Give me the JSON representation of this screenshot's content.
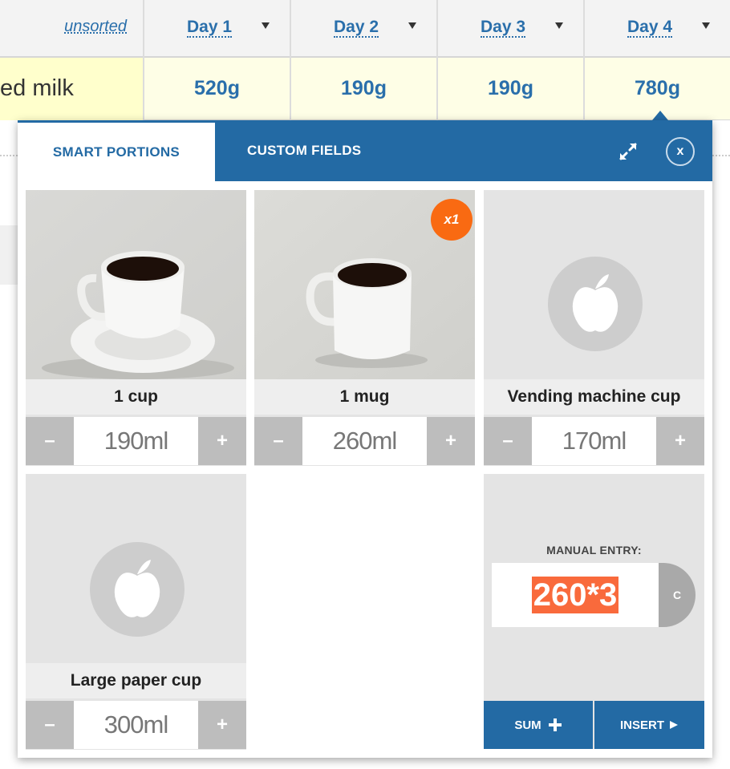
{
  "table": {
    "sort_label": "unsorted",
    "days": [
      {
        "label": "Day 1",
        "amount": "520g"
      },
      {
        "label": "Day 2",
        "amount": "190g"
      },
      {
        "label": "Day 3",
        "amount": "190g"
      },
      {
        "label": "Day 4",
        "amount": "780g"
      }
    ],
    "row_label": "ed milk"
  },
  "popup": {
    "tabs": {
      "smart": "SMART PORTIONS",
      "custom": "CUSTOM FIELDS"
    },
    "close_label": "x",
    "portions": [
      {
        "name": "1 cup",
        "value": "190ml",
        "minus": "–",
        "plus": "+",
        "image": "coffee-cup-saucer-photo"
      },
      {
        "name": "1 mug",
        "value": "260ml",
        "minus": "–",
        "plus": "+",
        "image": "coffee-mug-photo",
        "badge": "x1"
      },
      {
        "name": "Vending machine cup",
        "value": "170ml",
        "minus": "–",
        "plus": "+",
        "image": "apple-placeholder-icon"
      },
      {
        "name": "Large paper cup",
        "value": "300ml",
        "minus": "–",
        "plus": "+",
        "image": "apple-placeholder-icon"
      }
    ],
    "manual": {
      "label": "MANUAL ENTRY:",
      "value": "260*3",
      "clear_label": "C",
      "sum_label": "SUM",
      "insert_label": "INSERT"
    }
  },
  "colors": {
    "accent": "#236aa4",
    "badge": "#f96a12",
    "highlight": "#f96a3c"
  }
}
